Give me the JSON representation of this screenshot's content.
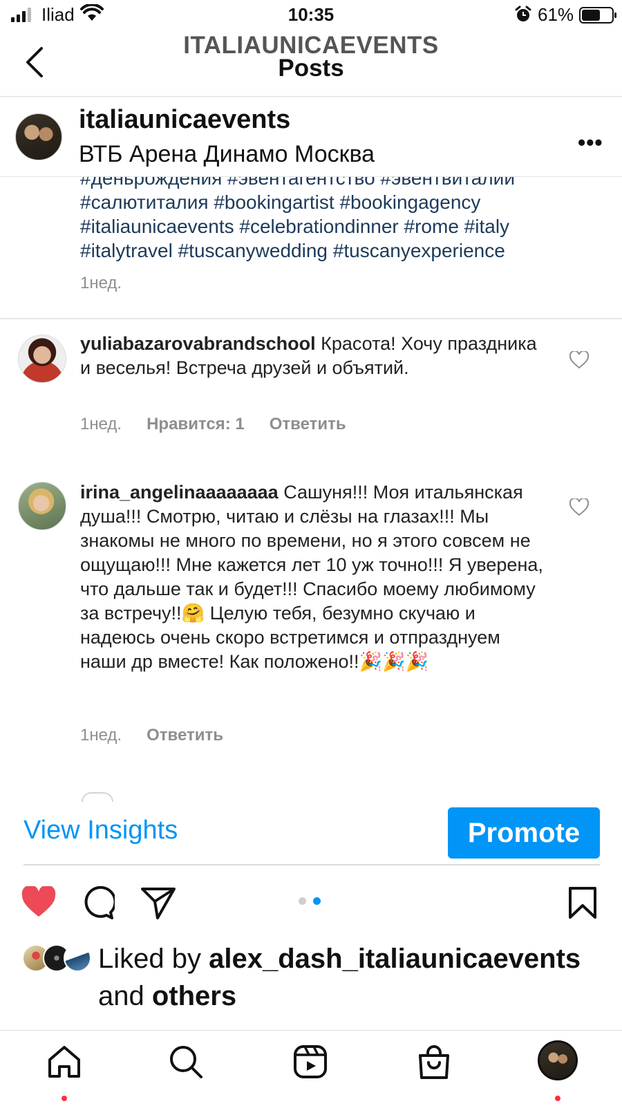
{
  "status_bar": {
    "carrier": "Iliad",
    "time": "10:35",
    "battery_percent": "61%",
    "battery_level": 0.61
  },
  "nav": {
    "account_name": "ITALIAUNICAEVENTS",
    "title": "Posts"
  },
  "post_header": {
    "username": "italiaunicaevents",
    "location": "ВТБ Арена Динамо Москва",
    "more_label": "•••"
  },
  "caption": {
    "hashtag_lines": [
      "#деньрождения #эвентагентство #эвентвиталии",
      "#салютиталия #bookingartist #bookingagency",
      "#italiaunicaevents #celebrationdinner #rome #italy",
      "#italytravel #tuscanywedding #tuscanyexperience"
    ],
    "time": "1нед."
  },
  "comments": [
    {
      "username": "yuliabazarovabrandschool",
      "text": " Красота! Хочу праздника  и веселья! Встреча друзей и объятий.",
      "time": "1нед.",
      "likes": "Нравится: 1",
      "reply": "Ответить"
    },
    {
      "username": "irina_angelinaaaaaaaa",
      "text": " Сашуня!!! Моя итальянская душа!!! Смотрю, читаю и слёзы на глазах!!! Мы знакомы не много по времени, но я этого совсем не ощущаю!!! Мне кажется лет 10 уж точно!!! Я уверена, что дальше так и будет!!! Спасибо моему любимому за встречу!!🤗 Целую тебя, безумно скучаю и надеюсь очень скоро встретимся и отпразднуем наши др вместе! Как положено!!🎉🎉🎉",
      "time": "1нед.",
      "reply": "Ответить"
    }
  ],
  "insights": {
    "view_label": "View Insights",
    "promote_label": "Promote"
  },
  "liked_by": {
    "prefix": "Liked by ",
    "user": "alex_dash_italiaunicaevents",
    "suffix": " and ",
    "others": "others"
  },
  "colors": {
    "accent_blue": "#0095f6",
    "like_red": "#ed4956",
    "hashtag": "#1d3a5a",
    "muted": "#8e8e8e"
  },
  "icons": {
    "actions": [
      "heart-filled-icon",
      "comment-icon",
      "share-icon",
      "bookmark-icon"
    ],
    "tabs": [
      "home-icon",
      "search-icon",
      "reels-icon",
      "shop-icon",
      "profile-avatar"
    ]
  }
}
